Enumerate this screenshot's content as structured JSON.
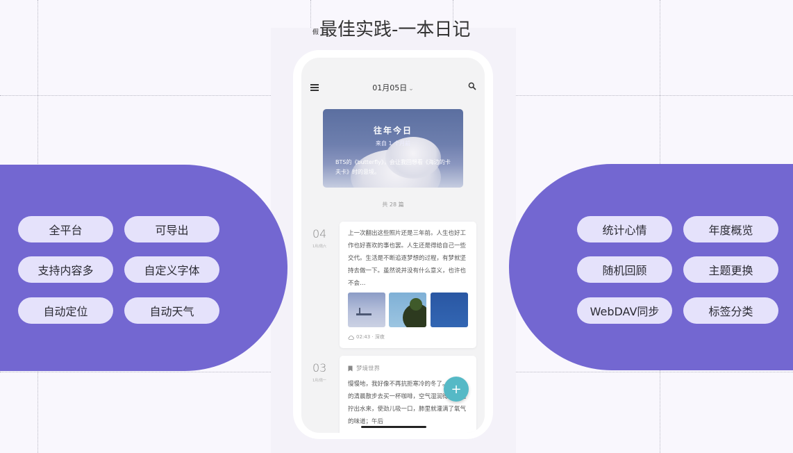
{
  "page": {
    "title_prefix": "假",
    "title": "最佳实践-一本日记"
  },
  "left_features": [
    "全平台",
    "可导出",
    "支持内容多",
    "自定义字体",
    "自动定位",
    "自动天气"
  ],
  "right_features": [
    "统计心情",
    "年度概览",
    "随机回顾",
    "主题更换",
    "WebDAV同步",
    "标签分类"
  ],
  "phone": {
    "header_date": "01月05日",
    "memory_card": {
      "title": "往年今日",
      "subtitle": "来自 1 个月前",
      "text": "BTS的《butterfly》，会让我回想看《海边的卡夫卡》时的意境。"
    },
    "total": "共 28 篇",
    "entries": [
      {
        "day": "04",
        "weekday": "1月/周六",
        "text": "上一次翻出这些照片还是三年前。人生也好工作也好喜欢的事也罢。人生还是得给自己一些交代。生活是不断追逐梦想的过程，有梦就坚持去做一下。虽然说并没有什么意义，也许也不会…",
        "time": "02:43 · 深夜"
      },
      {
        "day": "03",
        "weekday": "1月/周一",
        "place": "梦境世界",
        "text": "慢慢地，我好像不再抗拒寒冷的冬了。在起雾的清晨散步去买一杯咖啡，空气湿润得好像能拧出水来，使劲儿吸一口，肺里就灌满了氧气的味道；午后"
      }
    ],
    "fab_label": "+"
  },
  "colors": {
    "panel": "#7367d1",
    "pill": "#e5e2fb",
    "fab": "#55b9c6"
  },
  "icons": [
    "menu-icon",
    "chevron-down-icon",
    "search-icon",
    "cloud-icon",
    "bookmark-icon",
    "plus-icon"
  ]
}
